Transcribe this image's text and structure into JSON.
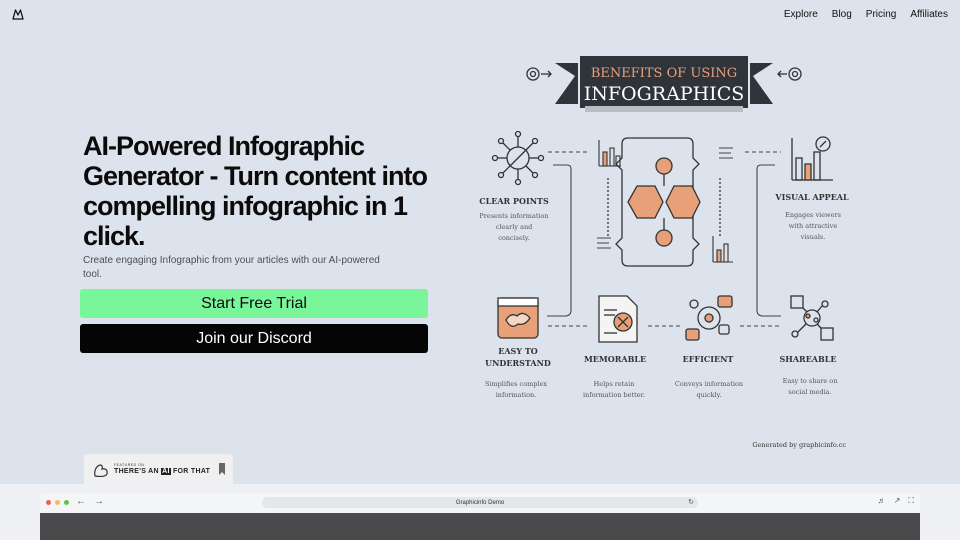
{
  "nav": {
    "links": [
      "Explore",
      "Blog",
      "Pricing",
      "Affiliates"
    ]
  },
  "hero": {
    "title": "AI-Powered Infographic Generator - Turn content into compelling infographic in 1 click.",
    "subtitle": "Create engaging Infographic from your articles with our AI-powered tool.",
    "trial_button": "Start Free Trial",
    "discord_button": "Join our Discord"
  },
  "badge": {
    "small": "FEATURED ON",
    "prefix": "THERE'S AN ",
    "ai": "AI",
    "suffix": " FOR THAT"
  },
  "infographic": {
    "title_line1": "BENEFITS OF USING",
    "title_line2": "INFOGRAPHICS",
    "items": [
      {
        "heading": "CLEAR POINTS",
        "desc1": "Presents information",
        "desc2": "clearly and",
        "desc3": "concisely."
      },
      {
        "heading": "VISUAL APPEAL",
        "desc1": "Engages viewers",
        "desc2": "with attractive",
        "desc3": "visuals."
      },
      {
        "heading1": "EASY TO",
        "heading2": "UNDERSTAND",
        "desc1": "Simplifies complex",
        "desc2": "information."
      },
      {
        "heading": "MEMORABLE",
        "desc1": "Helps retain",
        "desc2": "information better."
      },
      {
        "heading": "EFFICIENT",
        "desc1": "Conveys information",
        "desc2": "quickly."
      },
      {
        "heading": "SHAREABLE",
        "desc1": "Easy to share on",
        "desc2": "social media."
      }
    ],
    "credit": "Generated by graphicinfo.cc"
  },
  "browser": {
    "url": "Graphicinfo Demo",
    "dot_colors": [
      "#ee5f57",
      "#f4bd4f",
      "#5fc74a"
    ]
  }
}
